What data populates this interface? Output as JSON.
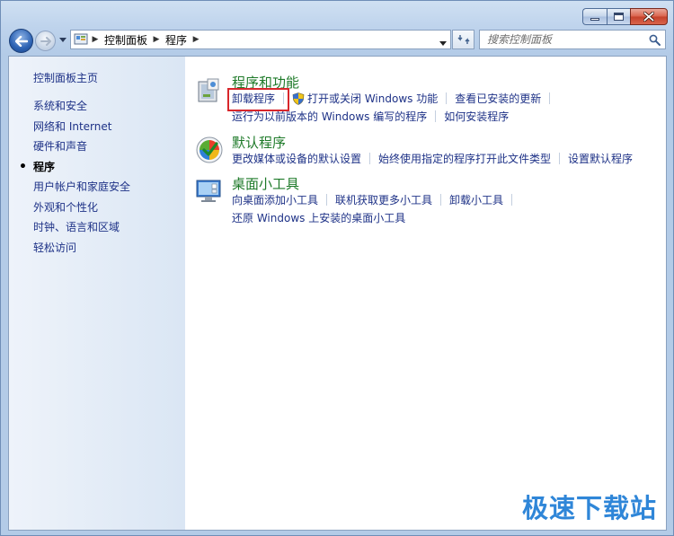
{
  "window": {
    "caption": {
      "minimize": "minimize",
      "maximize": "maximize",
      "close": "close"
    }
  },
  "address": {
    "breadcrumbs": [
      "控制面板",
      "程序"
    ]
  },
  "search": {
    "placeholder": "搜索控制面板"
  },
  "sidebar": {
    "home": "控制面板主页",
    "items": [
      {
        "label": "系统和安全",
        "current": false
      },
      {
        "label": "网络和 Internet",
        "current": false
      },
      {
        "label": "硬件和声音",
        "current": false
      },
      {
        "label": "程序",
        "current": true
      },
      {
        "label": "用户帐户和家庭安全",
        "current": false
      },
      {
        "label": "外观和个性化",
        "current": false
      },
      {
        "label": "时钟、语言和区域",
        "current": false
      },
      {
        "label": "轻松访问",
        "current": false
      }
    ]
  },
  "categories": [
    {
      "title": "程序和功能",
      "rows": [
        [
          "卸载程序",
          "打开或关闭 Windows 功能",
          "查看已安装的更新"
        ],
        [
          "运行为以前版本的 Windows 编写的程序",
          "如何安装程序"
        ]
      ]
    },
    {
      "title": "默认程序",
      "rows": [
        [
          "更改媒体或设备的默认设置",
          "始终使用指定的程序打开此文件类型",
          "设置默认程序"
        ]
      ]
    },
    {
      "title": "桌面小工具",
      "rows": [
        [
          "向桌面添加小工具",
          "联机获取更多小工具",
          "卸载小工具"
        ],
        [
          "还原 Windows 上安装的桌面小工具"
        ]
      ]
    }
  ],
  "watermark": "极速下载站",
  "colors": {
    "link": "#1e3287",
    "category_title": "#1e7a29",
    "highlight": "#d8262b",
    "watermark": "#2f86d8"
  }
}
